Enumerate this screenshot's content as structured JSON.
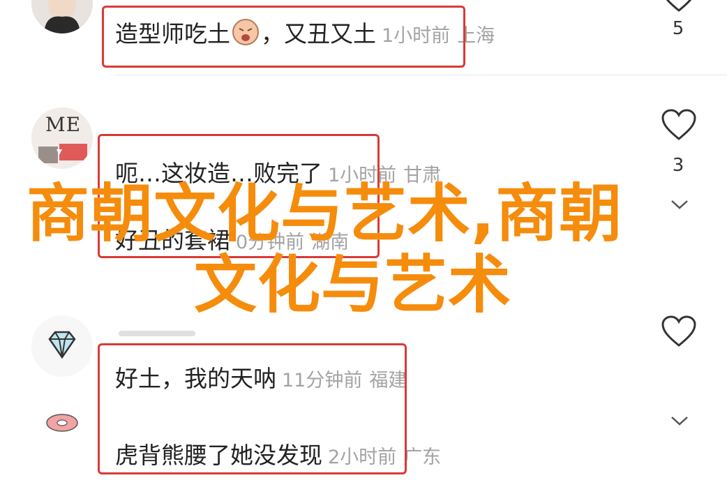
{
  "comments": [
    {
      "text": "造型师吃土",
      "emoji": "😣",
      "text_tail": "，又丑又土",
      "time": "1小时前",
      "location": "上海",
      "like_count": "5"
    },
    {
      "text": "呃…这妆造…败完了",
      "time": "1小时前",
      "location": "甘肃",
      "like_count": "3"
    },
    {
      "text": "好丑的套裙",
      "time": "0分钟前",
      "location": "湖南"
    },
    {
      "text": "好土，我的天呐",
      "time": "11分钟前",
      "location": "福建"
    },
    {
      "text": "虎背熊腰了她没发现",
      "time": "2小时前",
      "location": "广东"
    }
  ],
  "avatar2_text": "ME",
  "overlay": {
    "line1": "商朝文化与艺术,商朝",
    "line2": "文化与艺术",
    "color": "#f58c0c"
  },
  "colors": {
    "highlight_border": "#d93a36",
    "meta_text": "#a3a3a3",
    "comment_text": "#222222"
  },
  "icons": [
    "heart-outline-icon",
    "chevron-down-icon",
    "diamond-icon",
    "donut-icon"
  ]
}
